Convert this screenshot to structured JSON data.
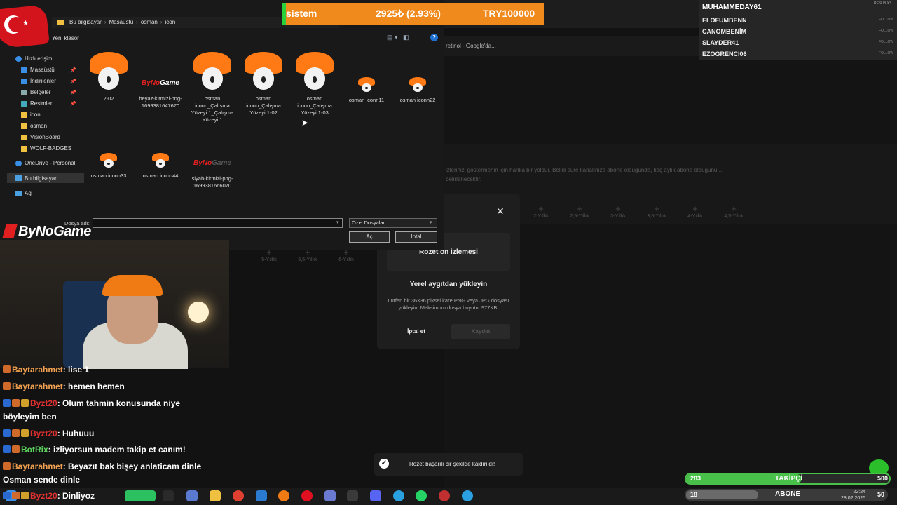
{
  "background_page": {
    "tab_text": "retinol - Google'da...",
    "description": "izlerinizi göstermenin için harika bir yoldur. Belirli süre kanalınıza abone olduğunda, kaç aylık abone olduğunu ... belirlenecektir.",
    "slots_row1": [
      "2-Yıllık",
      "2,5-Yıllık",
      "3-Yıllık",
      "3,5-Yıllık",
      "4-Yıllık",
      "4,5-Yıllık"
    ],
    "slots_row2": [
      "5-Yıllık",
      "5,5-Yıllık",
      "6-Yıllık"
    ]
  },
  "modal": {
    "close_symbol": "✕",
    "preview_label": "Rozet ön izlemesi",
    "upload_label": "Yerel aygıtdan yükleyin",
    "hint": "Lütfen bir 36×36 piksel kare PNG veya JPG dosyası yükleyin. Maksimum dosya boyutu: 977KB.",
    "cancel_label": "İptal et",
    "save_label": "Kaydet"
  },
  "toast": {
    "text": "Rozet başarılı bir şekilde kaldırıldı!"
  },
  "file_dialog": {
    "breadcrumb": [
      "Bu bilgisayar",
      "Masaüstü",
      "osman",
      "icon"
    ],
    "new_folder_label": "Yeni klasör",
    "help_symbol": "?",
    "nav": {
      "quick_access": "Hızlı erişim",
      "desktop": "Masaüstü",
      "downloads": "İndirilenler",
      "documents": "Belgeler",
      "pictures": "Resimler",
      "icon": "icon",
      "osman": "osman",
      "visionboard": "VisionBoard",
      "wolf": "WOLF-BADGES",
      "onedrive": "OneDrive - Personal",
      "this_pc": "Bu bilgisayar",
      "network": "Ağ"
    },
    "files": [
      "2-02",
      "beyaz-kirmizi-png-1699381647670",
      "osman iconn_Çalışma Yüzeyi 1_Çalışma Yüzeyi 1",
      "osman iconn_Çalışma Yüzeyi 1-02",
      "osman iconn_Çalışma Yüzeyi 1-03",
      "osman iconn11",
      "osman iconn22",
      "osman iconn33",
      "osman iconn44",
      "siyah-kirmizi-png-1699381666070"
    ],
    "filename_label": "Dosya adı:",
    "filename_value": "",
    "filetype_value": "Özel Dosyalar",
    "open_label": "Aç",
    "cancel_label": "İptal"
  },
  "ticker": {
    "name": "sistem",
    "change": "2925₺ (2.93%)",
    "balance": "TRY100000"
  },
  "followers": {
    "title": "MUHAMMEDAY61",
    "corner": "RESUB X3",
    "names": [
      "ELOFUMBENN",
      "CANOMBENİM",
      "SLAYDER41",
      "EZOGRENCI06"
    ],
    "tag": "FOLLOW"
  },
  "brand": {
    "logo_text": "ByNoGame",
    "logo_thumb_a": "ByNo",
    "logo_thumb_b": "Game"
  },
  "chat": [
    {
      "user": "Baytarahmet",
      "text": ": lise 1"
    },
    {
      "user": "Baytarahmet",
      "text": ": hemen hemen"
    },
    {
      "user": "Byzt20",
      "text": ": Olum tahmin konusunda niye"
    },
    {
      "user": "",
      "text": "böyleyim ben"
    },
    {
      "user": "Byzt20",
      "text": ": Huhuuu"
    },
    {
      "user": "BotRix",
      "text": ": izliyorsun madem takip et canım!"
    },
    {
      "user": "Baytarahmet",
      "text": ": Beyazıt bak bişey anlaticam dinle"
    },
    {
      "user": "",
      "text": "Osman sende dinle"
    },
    {
      "user": "Byzt20",
      "text": ": Dinliyoz"
    }
  ],
  "goals": {
    "follow_count": "283",
    "follow_label": "TAKİPÇİ",
    "follow_goal": "500",
    "follow_progress": 0.57,
    "sub_count": "18",
    "sub_label": "ABONE",
    "sub_goal": "50",
    "sub_progress": 0.36
  },
  "taskbar": {
    "time": "22:24",
    "date": "28.02.2025"
  }
}
